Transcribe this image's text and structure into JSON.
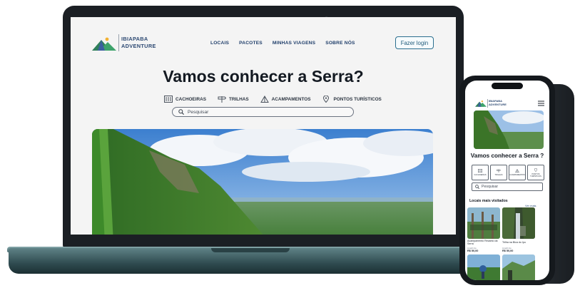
{
  "site": {
    "logo_line1": "IBIAPABA",
    "logo_line2": "ADVENTURE",
    "nav": [
      "LOCAIS",
      "PACOTES",
      "MINHAS VIAGENS",
      "SOBRE NÓS"
    ],
    "login_label": "Fazer login",
    "hero_title": "Vamos conhecer a Serra?",
    "categories": [
      "CACHOEIRAS",
      "TRILHAS",
      "ACAMPAMENTOS",
      "PONTOS TURÍSTICOS"
    ],
    "search_placeholder": "Pesquisar"
  },
  "mobile": {
    "logo_line1": "IBIAPABA",
    "logo_line2": "ADVENTURE",
    "hero_title": "Vamos conhecer a Serra ?",
    "categories": [
      "CACHOEIRAS",
      "TRILHAS",
      "ACAMPAMENTOS",
      "PONTOS TURÍSTICOS"
    ],
    "search_placeholder": "Pesquisar",
    "section_title": "Locais mais visitados",
    "see_more": "Ver mais",
    "cards": [
      {
        "name": "Acampamento Recanto da Serra",
        "from": "A partir de",
        "price": "R$ 50,00"
      },
      {
        "name": "Trilha na Bica do Ipu",
        "from": "A partir de",
        "price": "R$ 50,00"
      }
    ]
  },
  "colors": {
    "brand_navy": "#1f3e6a",
    "accent_teal": "#2b6f8f",
    "laptop_base": "#3f6064"
  }
}
